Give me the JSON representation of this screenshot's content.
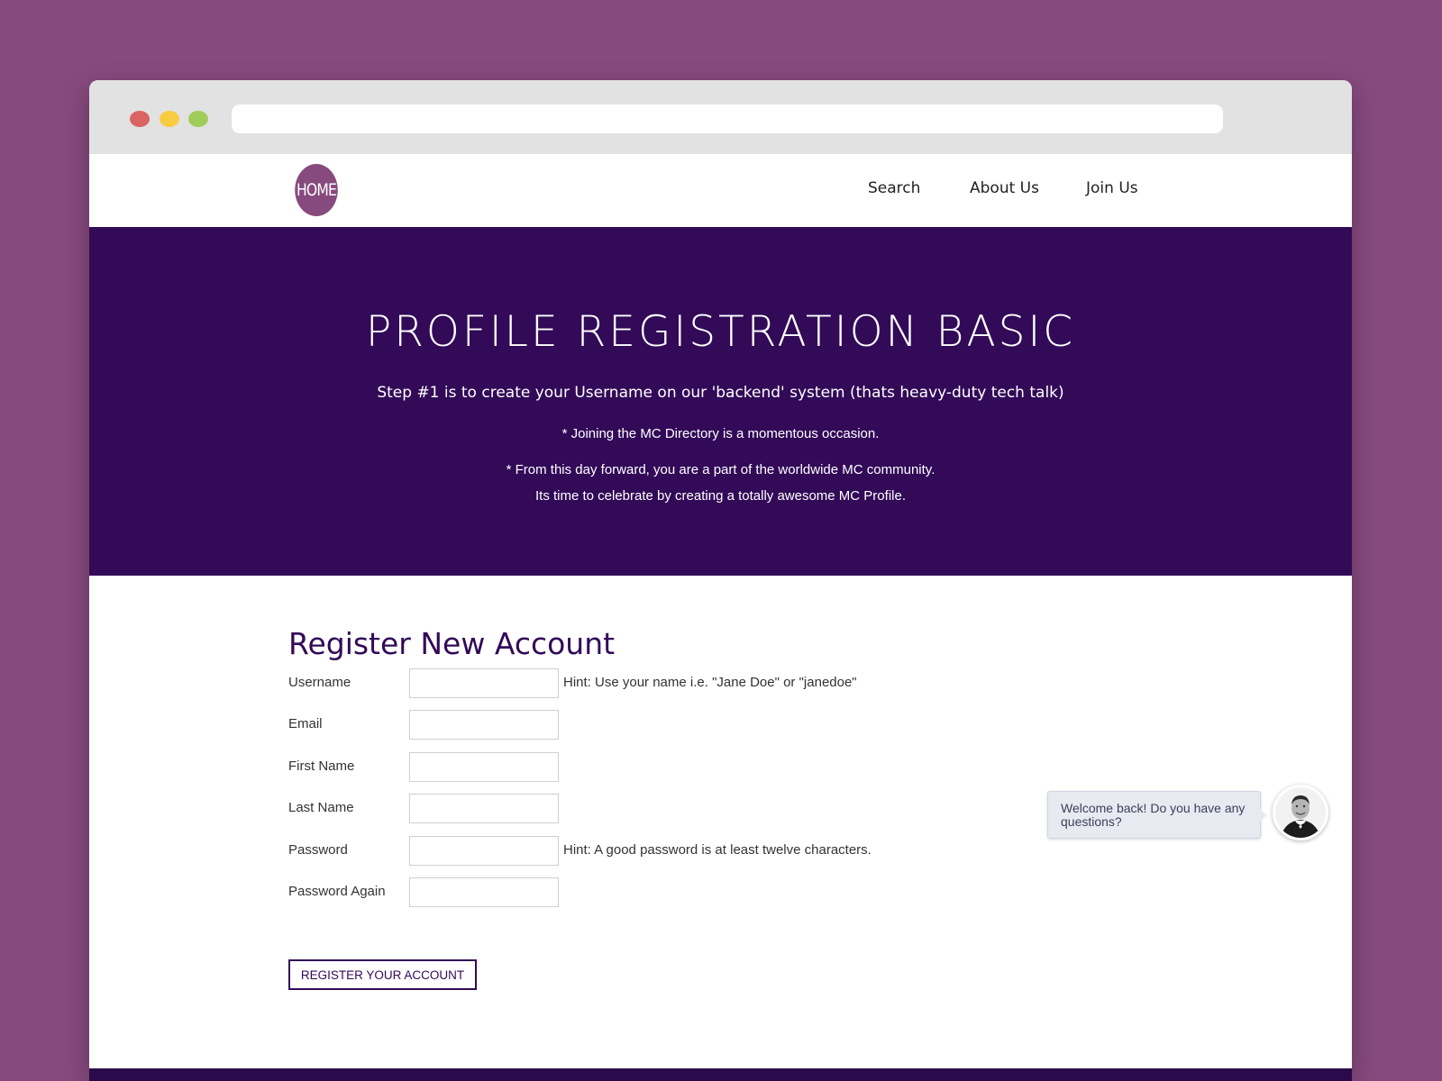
{
  "browser": {
    "url": ""
  },
  "nav": {
    "logo_text": "HOME",
    "items": [
      {
        "label": "Search"
      },
      {
        "label": "About Us"
      },
      {
        "label": "Join Us"
      }
    ]
  },
  "hero": {
    "title": "PROFILE REGISTRATION BASIC",
    "subtitle": "Step #1 is to create your Username on our 'backend' system (thats heavy-duty tech talk)",
    "lines": [
      "* Joining the MC Directory is a momentous occasion.",
      "* From this day forward, you are a part of the worldwide MC community.",
      "Its time to celebrate by creating a totally awesome MC Profile."
    ]
  },
  "form": {
    "title": "Register New Account",
    "fields": [
      {
        "label": "Username",
        "value": "",
        "hint": "Hint: Use your name i.e. \"Jane Doe\" or \"janedoe\""
      },
      {
        "label": "Email",
        "value": "",
        "hint": ""
      },
      {
        "label": "First Name",
        "value": "",
        "hint": ""
      },
      {
        "label": "Last Name",
        "value": "",
        "hint": ""
      },
      {
        "label": "Password",
        "value": "",
        "hint": "Hint: A good password is at least twelve characters."
      },
      {
        "label": "Password Again",
        "value": "",
        "hint": ""
      }
    ],
    "submit_label": "REGISTER YOUR ACCOUNT"
  },
  "chat": {
    "message": "Welcome back! Do you have any questions?",
    "avatar_icon": "agent-avatar"
  },
  "colors": {
    "background": "#874a7e",
    "hero": "#320a58",
    "accent": "#874a7e",
    "heading": "#320a58"
  }
}
